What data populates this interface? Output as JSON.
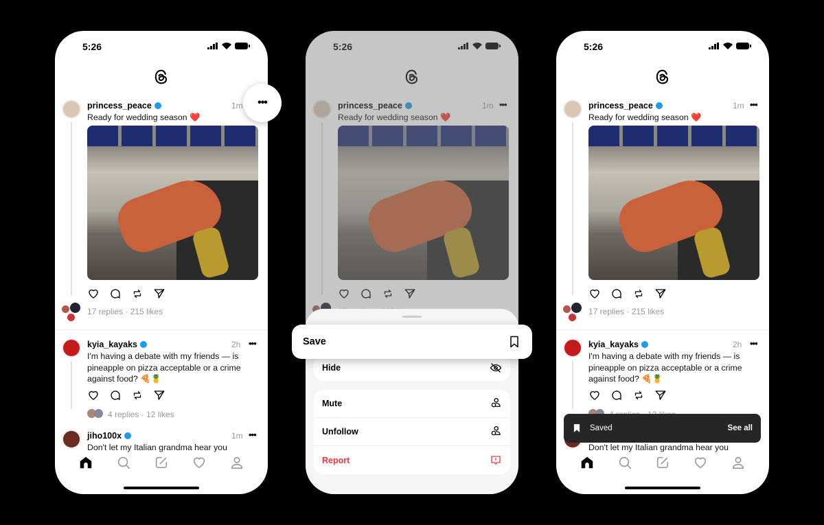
{
  "status": {
    "time": "5:26"
  },
  "feed": {
    "posts": [
      {
        "username": "princess_peace",
        "time": "1m",
        "text": "Ready for wedding season ❤️",
        "replies": "17 replies",
        "likes": "215 likes"
      },
      {
        "username": "kyia_kayaks",
        "time": "2h",
        "text": "I'm having a debate with my friends — is pineapple on pizza acceptable or a crime against food? 🍕🍍",
        "replies": "4 replies",
        "likes": "12 likes"
      },
      {
        "username": "jiho100x",
        "time": "1m",
        "text": "Don't let my Italian grandma hear you"
      }
    ],
    "separator": "·"
  },
  "menu": {
    "save": "Save",
    "hide": "Hide",
    "mute": "Mute",
    "unfollow": "Unfollow",
    "report": "Report",
    "report_color": "#ff3040"
  },
  "toast": {
    "label": "Saved",
    "action": "See all"
  },
  "nav": [
    "home-icon",
    "search-icon",
    "compose-icon",
    "heart-icon",
    "profile-icon"
  ]
}
